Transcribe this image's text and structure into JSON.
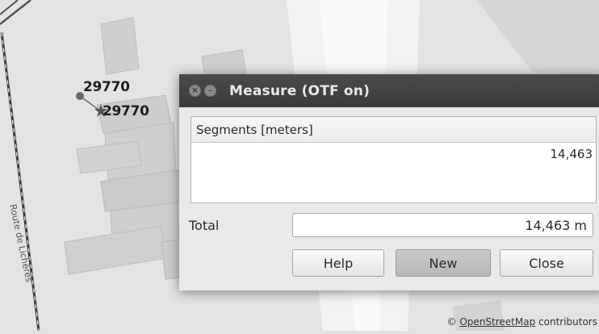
{
  "map": {
    "point_labels": [
      "29770",
      "29770"
    ],
    "road_name": "Route de Lichères",
    "attribution": {
      "prefix": "© ",
      "link": "OpenStreetMap",
      "suffix": " contributors"
    }
  },
  "dialog": {
    "title": "Measure (OTF on)",
    "segments_header": "Segments [meters]",
    "segments": [
      "14,463"
    ],
    "total_label": "Total",
    "total_value": "14,463 m",
    "buttons": {
      "help": "Help",
      "new": "New",
      "close": "Close"
    }
  }
}
